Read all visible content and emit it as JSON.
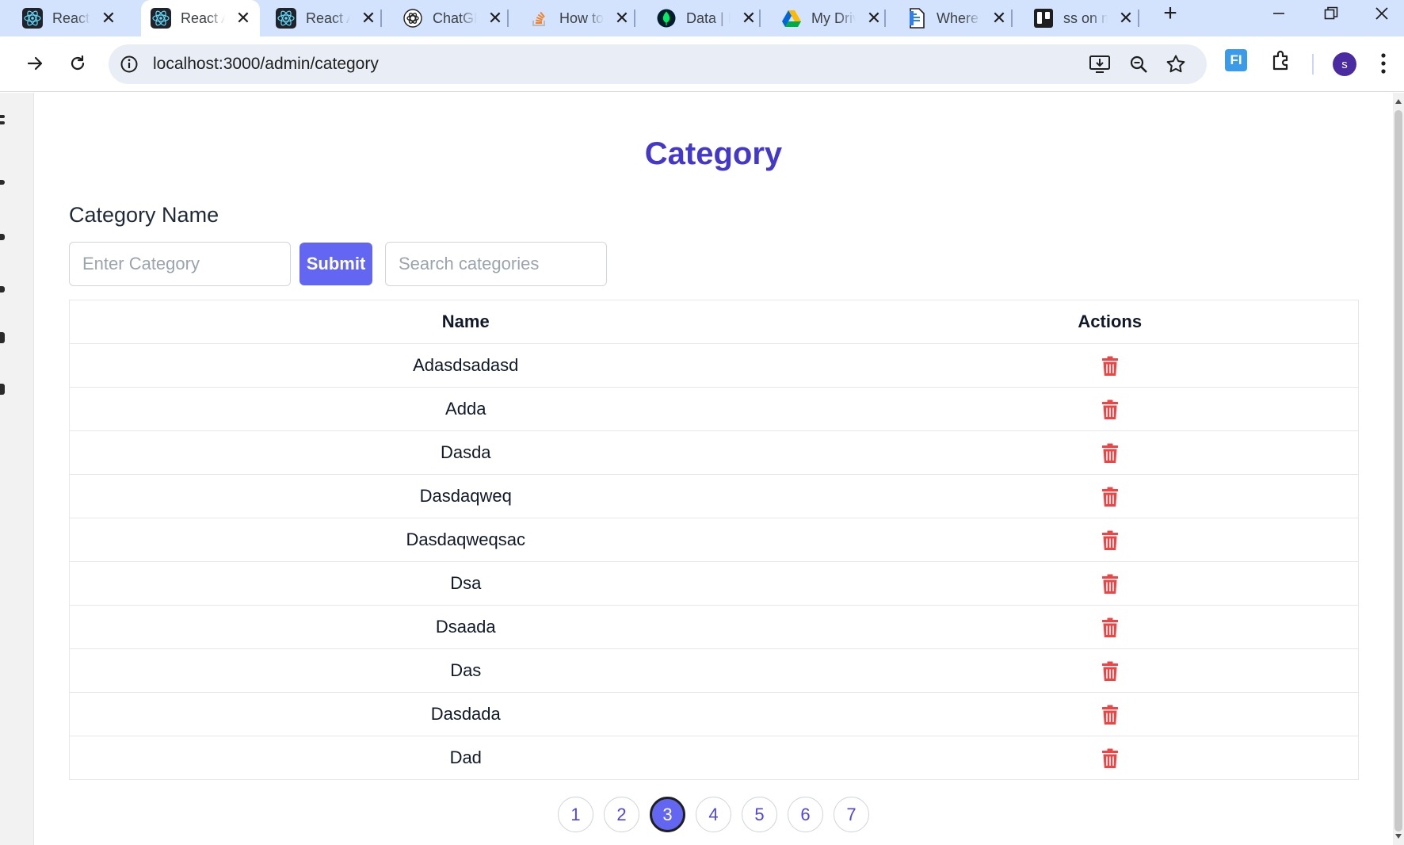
{
  "browser": {
    "tabs": [
      {
        "title": "React A",
        "icon": "react-icon"
      },
      {
        "title": "React A",
        "icon": "react-icon",
        "active": true
      },
      {
        "title": "React A",
        "icon": "react-icon"
      },
      {
        "title": "ChatGPT",
        "icon": "chatgpt-icon"
      },
      {
        "title": "How to",
        "icon": "stackoverflow-icon"
      },
      {
        "title": "Data | M",
        "icon": "mongodb-icon"
      },
      {
        "title": "My Drive",
        "icon": "google-drive-icon"
      },
      {
        "title": "Where",
        "icon": "document-icon"
      },
      {
        "title": "ss on m",
        "icon": "trello-icon"
      }
    ],
    "url": "localhost:3000/admin/category",
    "avatar_initial": "s",
    "extension_label": "FI"
  },
  "page": {
    "title": "Category",
    "field_label": "Category Name",
    "category_input": {
      "value": "",
      "placeholder": "Enter Category"
    },
    "submit_label": "Submit",
    "search_input": {
      "value": "",
      "placeholder": "Search categories"
    },
    "table": {
      "headers": [
        "Name",
        "Actions"
      ],
      "rows": [
        "Adasdsadasd",
        "Adda",
        "Dasda",
        "Dasdaqweq",
        "Dasdaqweqsac",
        "Dsa",
        "Dsaada",
        "Das",
        "Dasdada",
        "Dad"
      ]
    },
    "pagination": {
      "pages": [
        "1",
        "2",
        "3",
        "4",
        "5",
        "6",
        "7"
      ],
      "current": "3"
    }
  },
  "colors": {
    "accent": "#6366f1",
    "title": "#4338ca",
    "delete": "#ef4444",
    "tabstrip": "#d3e3fd"
  }
}
